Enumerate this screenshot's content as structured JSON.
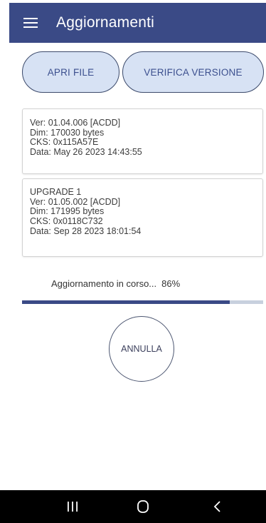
{
  "app_bar": {
    "title": "Aggiornamenti",
    "color": "#3a4a86"
  },
  "buttons": {
    "open_file": "APRI FILE",
    "verify_version": "VERIFICA VERSIONE",
    "cancel": "ANNULLA"
  },
  "current_version": {
    "ver": "Ver: 01.04.006 [ACDD]",
    "dim": "Dim: 170030 bytes",
    "cks": "CKS: 0x115A57E",
    "date": "Data: May 26 2023 14:43:55"
  },
  "upgrade": {
    "name": "UPGRADE 1",
    "ver": "Ver: 01.05.002 [ACDD]",
    "dim": "Dim: 171995 bytes",
    "cks": "CKS: 0x0118C732",
    "date": "Data: Sep 28 2023 18:01:54"
  },
  "progress": {
    "label": "Aggiornamento in corso...",
    "percent_text": "86%",
    "fraction": 0.86
  },
  "nav": {
    "icons": [
      "recent-apps-icon",
      "home-icon",
      "back-icon"
    ]
  }
}
